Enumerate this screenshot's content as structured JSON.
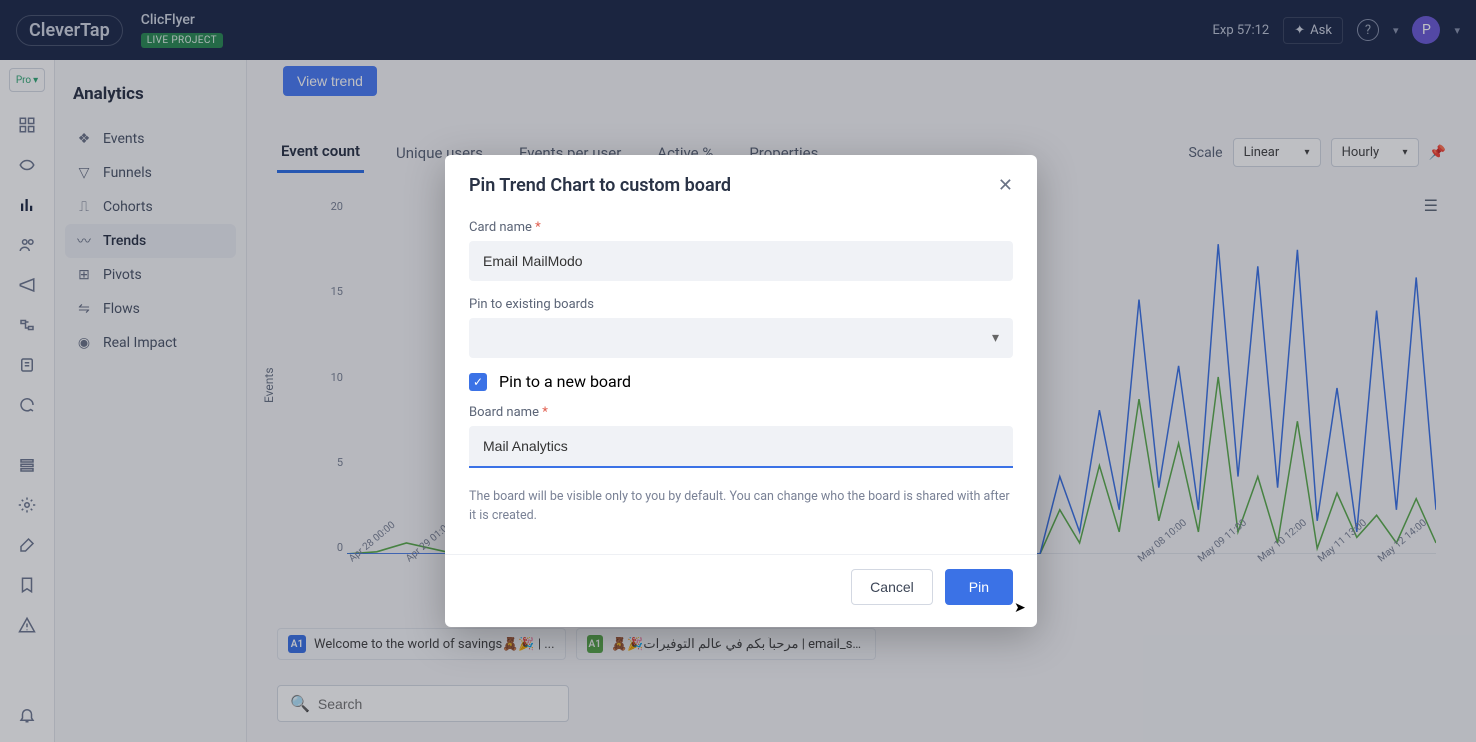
{
  "header": {
    "logo": "CleverTap",
    "project_name": "ClicFlyer",
    "badge": "LIVE PROJECT",
    "exp": "Exp 57:12",
    "ask": "Ask",
    "avatar_initial": "P"
  },
  "sidebar": {
    "title": "Analytics",
    "items": [
      {
        "label": "Events"
      },
      {
        "label": "Funnels"
      },
      {
        "label": "Cohorts"
      },
      {
        "label": "Trends",
        "active": true
      },
      {
        "label": "Pivots"
      },
      {
        "label": "Flows"
      },
      {
        "label": "Real Impact"
      }
    ]
  },
  "main": {
    "view_trend": "View trend",
    "tabs": [
      {
        "label": "Event count",
        "active": true
      },
      {
        "label": "Unique users"
      },
      {
        "label": "Events per user"
      },
      {
        "label": "Active %"
      },
      {
        "label": "Properties"
      }
    ],
    "scale_label": "Scale",
    "scale_value": "Linear",
    "granularity": "Hourly",
    "search_placeholder": "Search"
  },
  "chart_data": {
    "type": "line",
    "ylabel": "Events",
    "ylim": [
      0,
      20
    ],
    "yticks": [
      20,
      15,
      10,
      5,
      0
    ],
    "xticks": [
      "Apr 28 00:00",
      "Apr 29 01:00",
      "May 08 10:00",
      "May 09 11:00",
      "May 10 12:00",
      "May 11 13:00",
      "May 12 14:00"
    ],
    "series": [
      {
        "name": "A1",
        "color": "#3b72e6",
        "label": "Welcome to the world of savings🧸🎉 | ..."
      },
      {
        "name": "A1",
        "color": "#5aab4d",
        "label": "🧸🎉مرحباً بكم في عالم التوفيرات | email_subject"
      }
    ]
  },
  "modal": {
    "title": "Pin Trend Chart to custom board",
    "card_name_label": "Card name",
    "card_name_value": "Email MailModo",
    "existing_label": "Pin to existing boards",
    "existing_value": "",
    "new_board_check": "Pin to a new board",
    "board_name_label": "Board name",
    "board_name_value": "Mail Analytics",
    "help": "The board will be visible only to you by default. You can change who the board is shared with after it is created.",
    "cancel": "Cancel",
    "pin": "Pin"
  }
}
